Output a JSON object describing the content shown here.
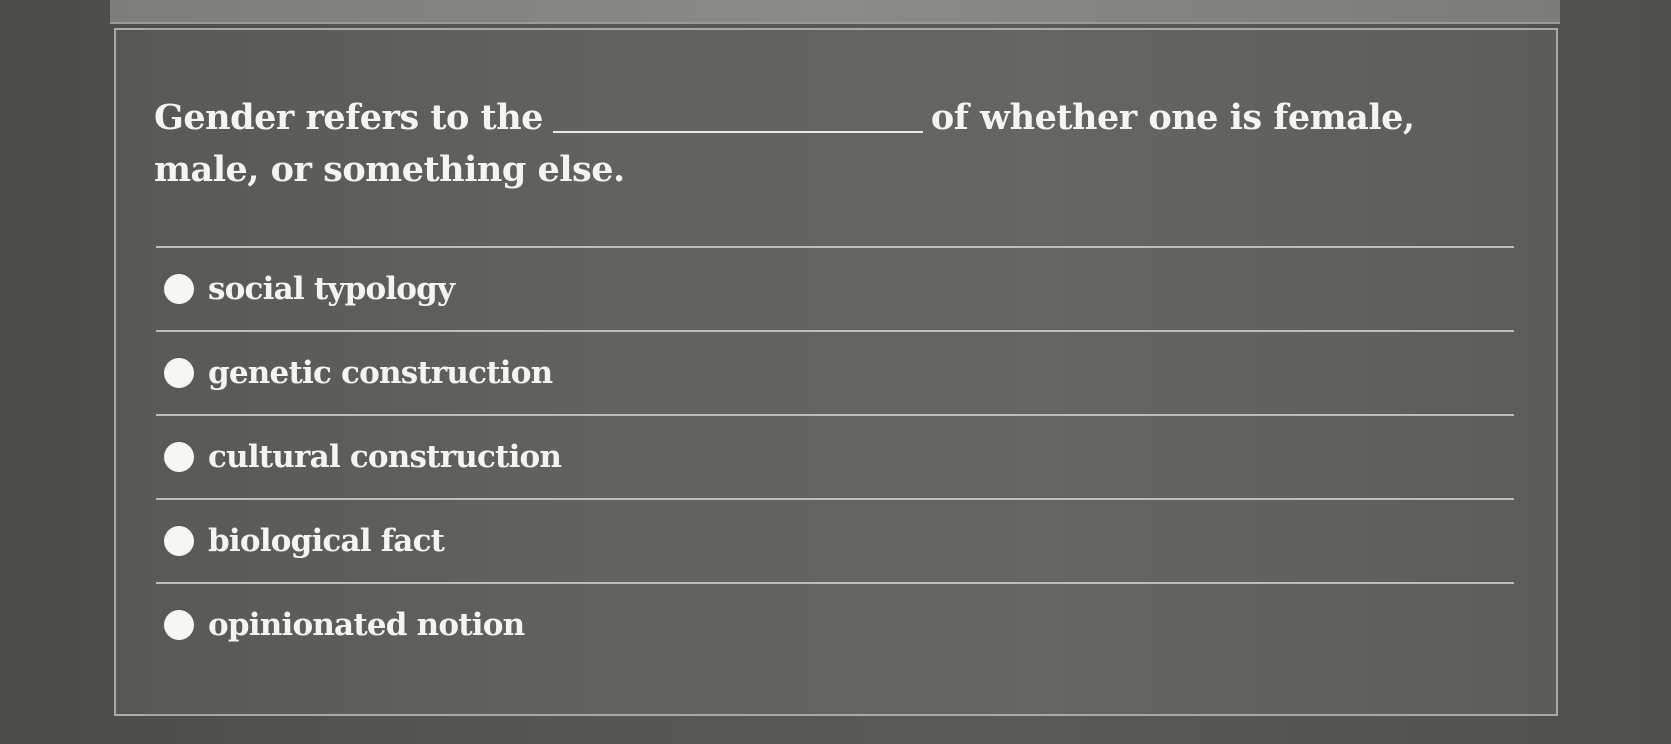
{
  "question": {
    "prefix": "Gender refers to the",
    "suffix": "of whether one is female, male, or something else."
  },
  "options": [
    {
      "label": "social typology",
      "selected": false
    },
    {
      "label": "genetic construction",
      "selected": false
    },
    {
      "label": "cultural construction",
      "selected": false
    },
    {
      "label": "biological fact",
      "selected": false
    },
    {
      "label": "opinionated notion",
      "selected": false
    }
  ],
  "colors": {
    "background": "#555552",
    "card": "#62625e",
    "text": "#f4f4f1",
    "divider": "#bdbdb9",
    "radio": "#f6f6f3"
  }
}
